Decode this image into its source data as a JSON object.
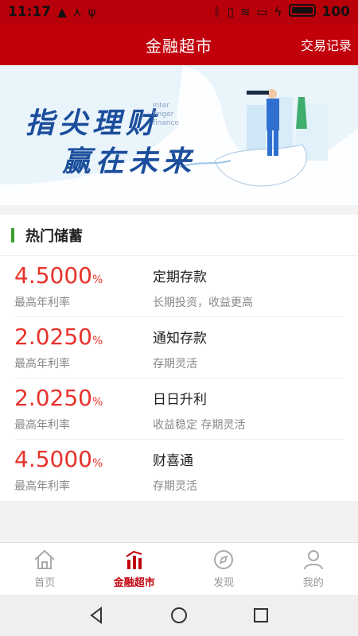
{
  "status_bar": {
    "time": "11:17",
    "battery": "100"
  },
  "header": {
    "title": "金融超市",
    "action": "交易记录"
  },
  "banner": {
    "line1": "指尖理财",
    "line2": "赢在未来",
    "sub1": "Inter",
    "sub2": "finger",
    "sub3": "finance"
  },
  "section": {
    "title": "热门储蓄"
  },
  "products": [
    {
      "rate": "4.5000",
      "unit": "%",
      "rate_label": "最高年利率",
      "name": "定期存款",
      "desc": "长期投资，收益更高"
    },
    {
      "rate": "2.0250",
      "unit": "%",
      "rate_label": "最高年利率",
      "name": "通知存款",
      "desc": "存期灵活"
    },
    {
      "rate": "2.0250",
      "unit": "%",
      "rate_label": "最高年利率",
      "name": "日日升利",
      "desc": "收益稳定 存期灵活"
    },
    {
      "rate": "4.5000",
      "unit": "%",
      "rate_label": "最高年利率",
      "name": "财喜通",
      "desc": "存期灵活"
    }
  ],
  "nav": [
    {
      "label": "首页",
      "icon": "home-icon"
    },
    {
      "label": "金融超市",
      "icon": "finance-market-icon"
    },
    {
      "label": "发现",
      "icon": "compass-icon"
    },
    {
      "label": "我的",
      "icon": "profile-icon"
    }
  ],
  "colors": {
    "brand_red": "#c1000c",
    "rate_red": "#e8322b",
    "accent_green": "#3aa12f"
  }
}
